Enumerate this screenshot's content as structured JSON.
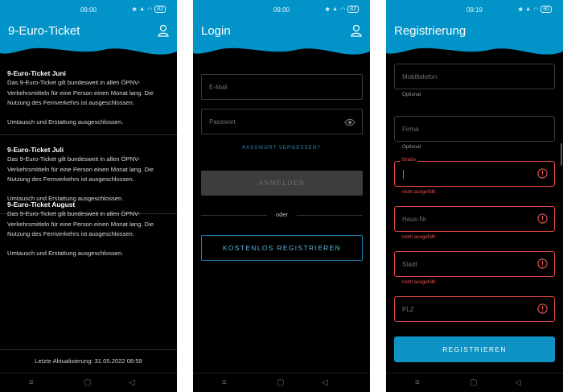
{
  "colors": {
    "primary": "#0294c8",
    "error": "#e04848",
    "link": "#2d88b4"
  },
  "icons": {
    "user": "user-icon",
    "eye": "eye-icon",
    "warning": "warning-circle-icon",
    "nav": [
      "menu-icon",
      "home-square-icon",
      "back-triangle-icon"
    ]
  },
  "status_bar": {
    "p1": {
      "time": "09:00",
      "battery": "82"
    },
    "p2": {
      "time": "09:00",
      "battery": "82"
    },
    "p3": {
      "time": "09:19",
      "battery": "80"
    }
  },
  "screen1": {
    "title": "9-Euro-Ticket",
    "tickets": [
      {
        "title": "9-Euro-Ticket Juni",
        "description": "Das 9-Euro-Ticket gilt bundesweit in allen ÖPNV-Verkehrsmitteln für eine Person einen Monat lang. Die Nutzung des Fernverkehrs ist ausgeschlossen.",
        "note": "Umtausch und Erstattung ausgeschlossen."
      },
      {
        "title": "9-Euro-Ticket Juli",
        "description": "Das 9-Euro-Ticket gilt bundesweit in allen ÖPNV-Verkehrsmitteln für eine Person einen Monat lang. Die Nutzung des Fernverkehrs ist ausgeschlossen.",
        "note": "Umtausch und Erstattung ausgeschlossen."
      },
      {
        "title": "9-Euro-Ticket August",
        "description": "Das 9-Euro-Ticket gilt bundesweit in allen ÖPNV-Verkehrsmitteln für eine Person einen Monat lang. Die Nutzung des Fernverkehrs ist ausgeschlossen.",
        "note": "Umtausch und Erstattung ausgeschlossen."
      }
    ],
    "footer": "Letzte Aktualisierung:  31.05.2022 08:59"
  },
  "screen2": {
    "title": "Login",
    "email_placeholder": "E-Mail",
    "password_placeholder": "Passwort",
    "forgot_password": "PASSWORT VERGESSEN?",
    "login_button": "ANMELDEN",
    "or": "oder",
    "register_button": "KOSTENLOS REGISTRIEREN"
  },
  "screen3": {
    "title": "Registrierung",
    "fields": {
      "mobile": {
        "placeholder": "Mobiltelefon",
        "hint": "Optional"
      },
      "company": {
        "placeholder": "Firma",
        "hint": "Optional"
      },
      "street": {
        "label": "Straße",
        "hint": "nicht ausgefüllt"
      },
      "house_number": {
        "placeholder": "Haus-Nr.",
        "hint": "nicht ausgefüllt"
      },
      "city": {
        "placeholder": "Stadt",
        "hint": "nicht ausgefüllt"
      },
      "zip": {
        "placeholder": "PLZ"
      }
    },
    "register_button": "REGISTRIEREN"
  }
}
